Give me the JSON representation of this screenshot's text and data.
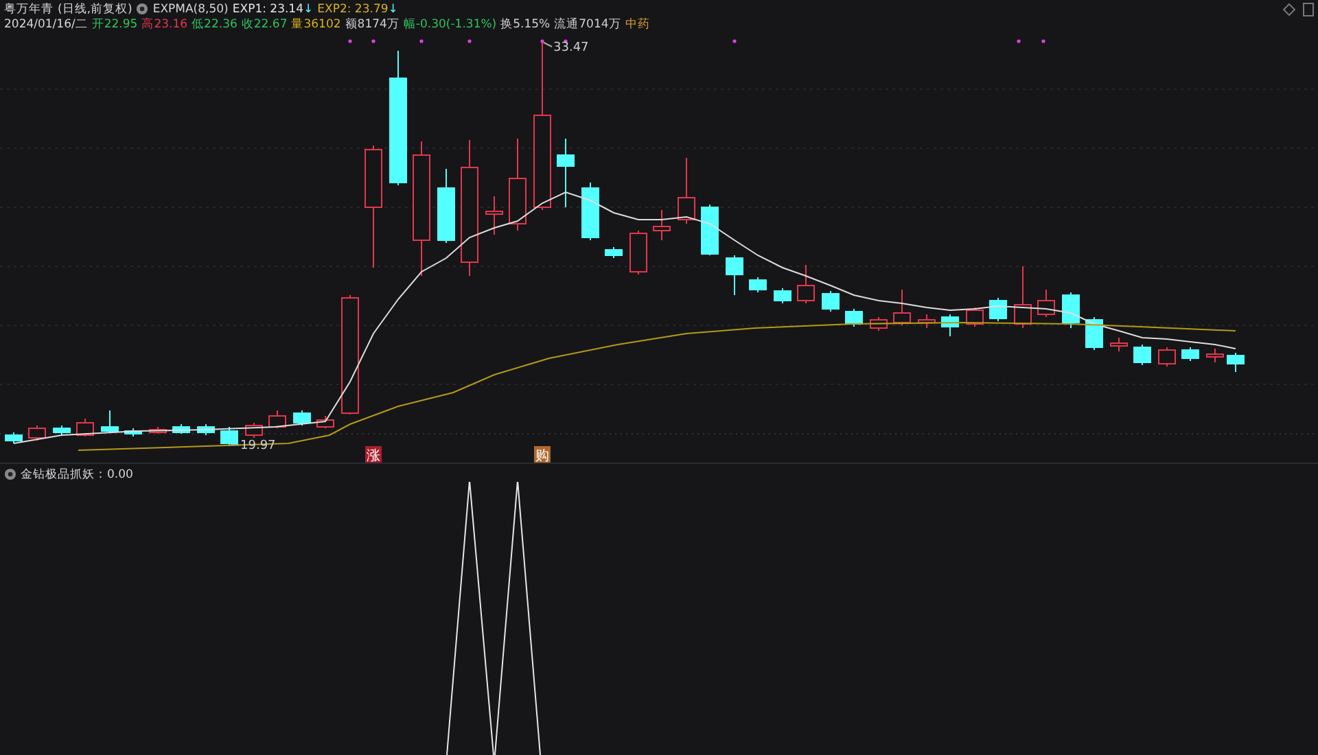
{
  "header": {
    "stock": "粤万年青",
    "period": "(日线,前复权)",
    "indicator": "EXPMA(8,50)",
    "values": [
      {
        "text": "EXP1: 23.14",
        "arrow": "↓",
        "color": "#e6e6e6"
      },
      {
        "text": "EXP2: 23.79",
        "arrow": "↓",
        "color": "#d8b31c"
      }
    ]
  },
  "quote": {
    "date": "2024/01/16/二",
    "fields": [
      {
        "text": "开22.95",
        "color": "#2fc25b"
      },
      {
        "text": "高23.16",
        "color": "#e5364c"
      },
      {
        "text": "低22.36",
        "color": "#2fc25b"
      },
      {
        "text": "收22.67",
        "color": "#2fc25b"
      },
      {
        "text": "量36102",
        "color": "#d8b31c"
      },
      {
        "text": "额8174万",
        "color": "#d0d0d0"
      },
      {
        "text": "幅-0.30(-1.31%)",
        "color": "#2fc25b"
      },
      {
        "text": "换5.15%",
        "color": "#d0d0d0"
      },
      {
        "text": "流通7014万",
        "color": "#d0d0d0"
      },
      {
        "text": "中药",
        "color": "#e0a030"
      }
    ]
  },
  "price_chart": {
    "high_label": "33.47",
    "low_label": "19.97",
    "markers": [
      {
        "text": "涨",
        "kind": "up"
      },
      {
        "text": "购",
        "kind": "buy"
      }
    ]
  },
  "indicator_pane": {
    "title": "金钻极品抓妖：0.00"
  }
}
